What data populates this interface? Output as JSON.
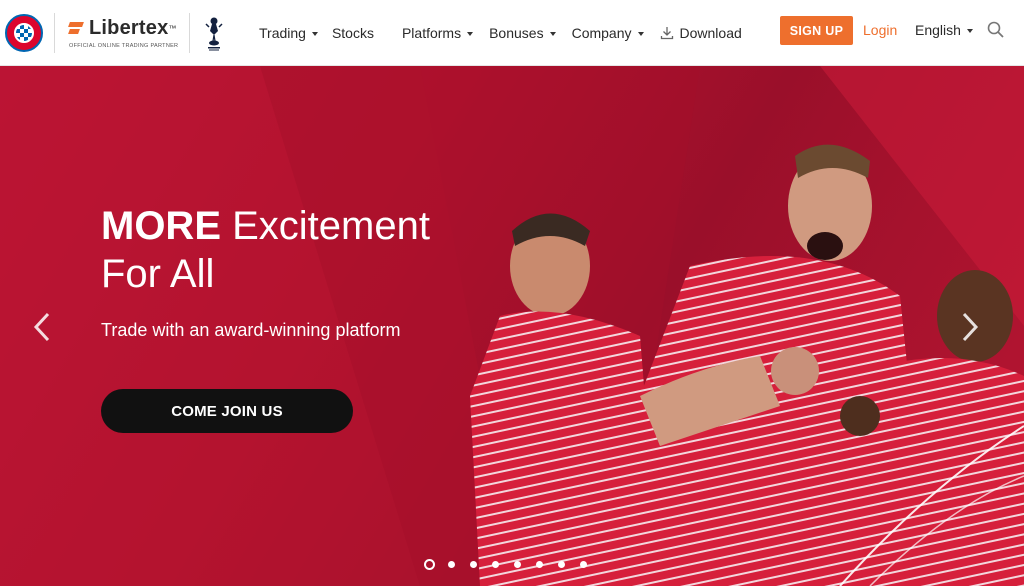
{
  "header": {
    "partner_logo_text": "Libertex",
    "partner_logo_tagline": "Official online trading partner",
    "nav": [
      {
        "label": "Trading",
        "has_dropdown": true
      },
      {
        "label": "Stocks",
        "has_dropdown": false
      },
      {
        "label": "Platforms",
        "has_dropdown": true
      },
      {
        "label": "Bonuses",
        "has_dropdown": true
      },
      {
        "label": "Company",
        "has_dropdown": true
      },
      {
        "label": "Download",
        "has_dropdown": false,
        "icon": "download-icon"
      }
    ],
    "signup_label": "SIGN UP",
    "login_label": "Login",
    "language_label": "English",
    "search_icon": "search-icon"
  },
  "hero": {
    "title_strong": "MORE",
    "title_rest": " Excitement",
    "title_line2": "For All",
    "subtitle": "Trade with an award-winning platform",
    "cta_label": "COME JOIN US",
    "slide_count": 8,
    "active_slide": 1
  },
  "colors": {
    "accent": "#ee6f2d",
    "hero_red": "#b3122f",
    "cta_bg": "#111111"
  }
}
